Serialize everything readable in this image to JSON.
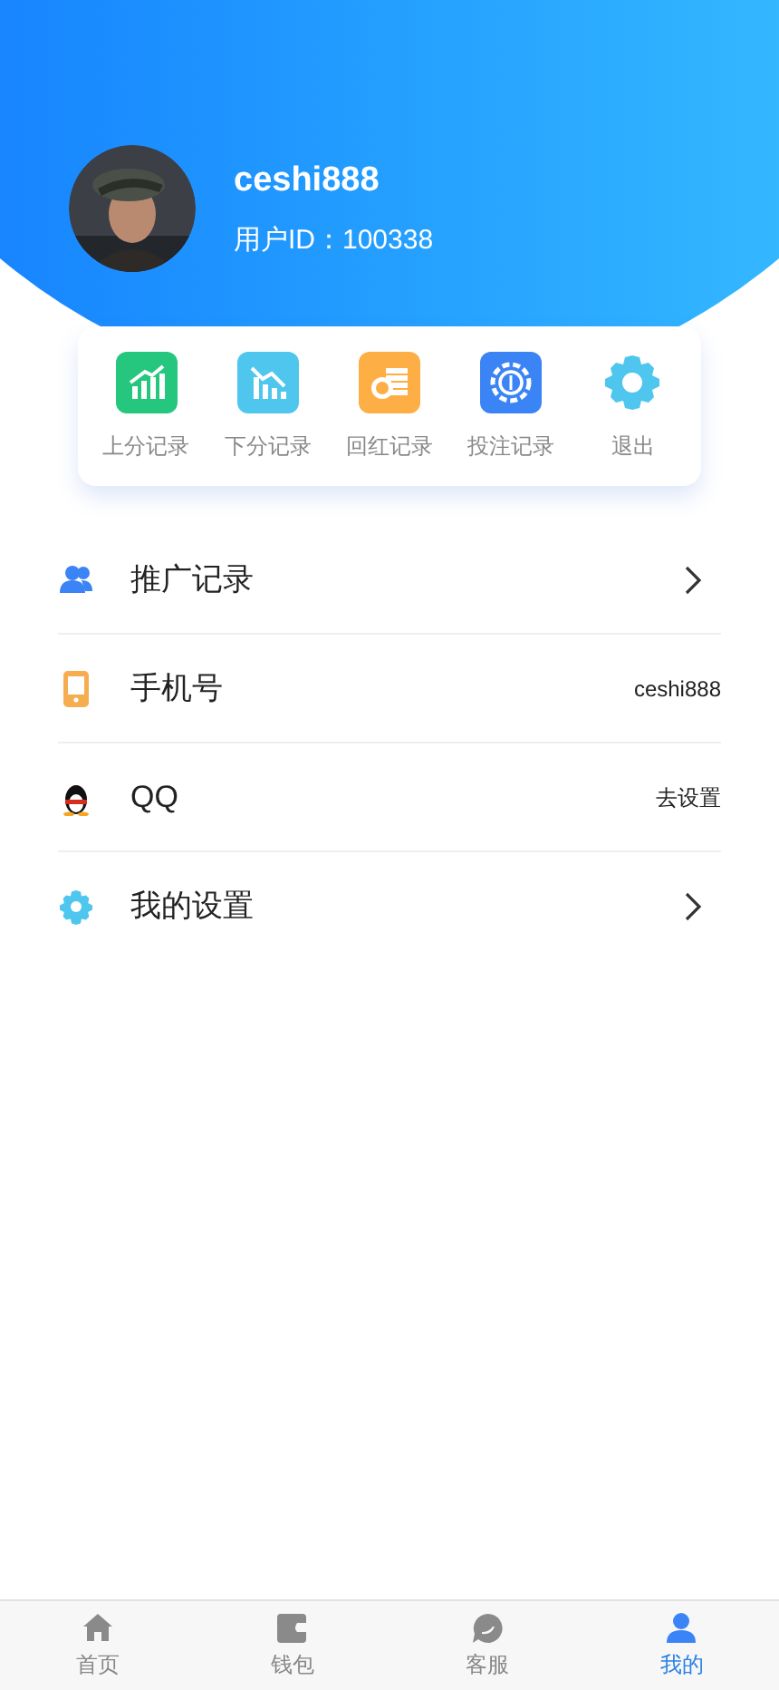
{
  "profile": {
    "username": "ceshi888",
    "user_id": "用户ID：100338"
  },
  "quick_actions": [
    {
      "label": "上分记录"
    },
    {
      "label": "下分记录"
    },
    {
      "label": "回红记录"
    },
    {
      "label": "投注记录"
    },
    {
      "label": "退出"
    }
  ],
  "menu": [
    {
      "label": "推广记录",
      "kind": "link"
    },
    {
      "label": "手机号",
      "kind": "value",
      "value": "ceshi888"
    },
    {
      "label": "QQ",
      "kind": "value",
      "value": "去设置"
    },
    {
      "label": "我的设置",
      "kind": "link"
    }
  ],
  "tab_bar": [
    {
      "label": "首页",
      "selected": false
    },
    {
      "label": "钱包",
      "selected": false
    },
    {
      "label": "客服",
      "selected": false
    },
    {
      "label": "我的",
      "selected": true
    }
  ]
}
